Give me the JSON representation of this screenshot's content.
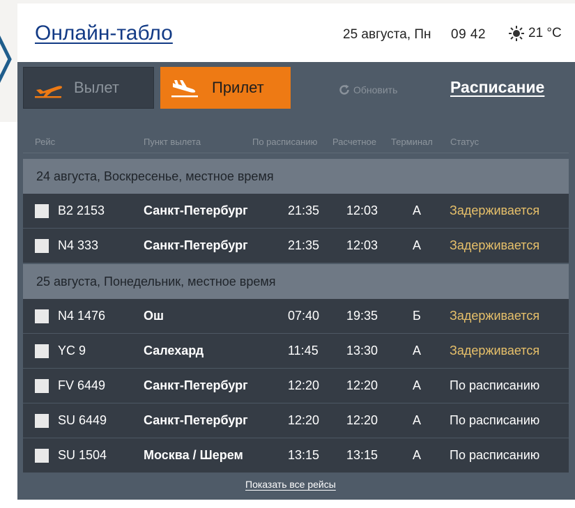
{
  "header": {
    "title": "Онлайн-табло",
    "date": "25 августа, Пн",
    "time": "09  42",
    "temperature": "21 °C",
    "weather_icon": "sun-icon",
    "title_color": "#123a85"
  },
  "tabs": {
    "departure_label": "Вылет",
    "arrival_label": "Прилет",
    "active": "arrival",
    "active_color": "#ee7a14"
  },
  "toolbar": {
    "refresh_label": "Обновить",
    "schedule_link": "Расписание"
  },
  "columns": [
    "Рейс",
    "Пункт вылета",
    "По расписанию",
    "Расчетное",
    "Терминал",
    "Статус"
  ],
  "days": [
    {
      "label": "24 августа, Воскресенье, местное время",
      "flights": [
        {
          "flight": "B2 2153",
          "city": "Санкт-Петербург",
          "scheduled": "21:35",
          "estimated": "12:03",
          "terminal": "A",
          "status": "Задерживается",
          "delayed": true
        },
        {
          "flight": "N4 333",
          "city": "Санкт-Петербург",
          "scheduled": "21:35",
          "estimated": "12:03",
          "terminal": "A",
          "status": "Задерживается",
          "delayed": true
        }
      ]
    },
    {
      "label": "25 августа, Понедельник, местное время",
      "flights": [
        {
          "flight": "N4 1476",
          "city": "Ош",
          "scheduled": "07:40",
          "estimated": "19:35",
          "terminal": "Б",
          "status": "Задерживается",
          "delayed": true
        },
        {
          "flight": "YC 9",
          "city": "Салехард",
          "scheduled": "11:45",
          "estimated": "13:30",
          "terminal": "A",
          "status": "Задерживается",
          "delayed": true
        },
        {
          "flight": "FV 6449",
          "city": "Санкт-Петербург",
          "scheduled": "12:20",
          "estimated": "12:20",
          "terminal": "A",
          "status": "По расписанию",
          "delayed": false
        },
        {
          "flight": "SU 6449",
          "city": "Санкт-Петербург",
          "scheduled": "12:20",
          "estimated": "12:20",
          "terminal": "A",
          "status": "По расписанию",
          "delayed": false
        },
        {
          "flight": "SU 1504",
          "city": "Москва / Шерем",
          "scheduled": "13:15",
          "estimated": "13:15",
          "terminal": "A",
          "status": "По расписанию",
          "delayed": false
        }
      ]
    }
  ],
  "footer": {
    "show_all_label": "Показать все рейсы"
  },
  "colors": {
    "board_bg": "#4f5b68",
    "row_bg": "#353c45",
    "day_header_bg": "#6f7985",
    "delay_status": "#e7c06a"
  }
}
